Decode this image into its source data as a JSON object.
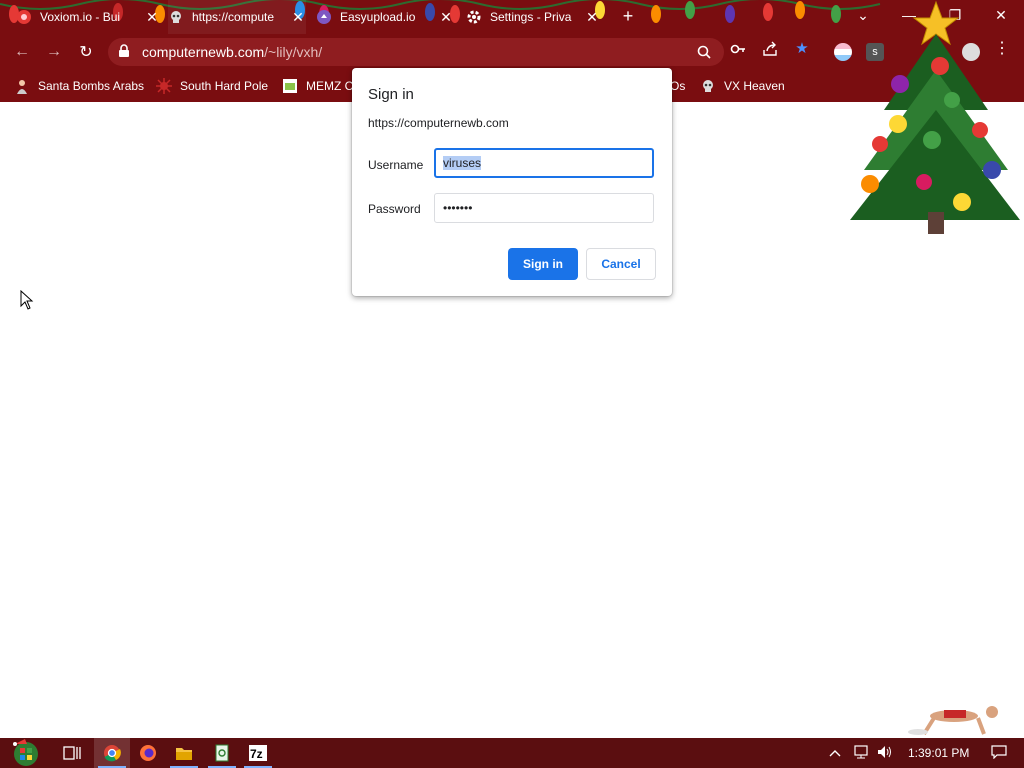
{
  "tabs": [
    {
      "title": "Voxiom.io - Bui",
      "favicon": "voxiom-icon",
      "active": false
    },
    {
      "title": "https://compute",
      "favicon": "pirate-icon",
      "active": true
    },
    {
      "title": "Easyupload.io",
      "favicon": "easyupload-icon",
      "active": false
    },
    {
      "title": "Settings - Priva",
      "favicon": "gear-icon",
      "active": false
    }
  ],
  "tab_close_glyph": "✕",
  "new_tab_glyph": "+",
  "window_controls": {
    "dropdown": "⌄",
    "minimize": "—",
    "restore": "❐",
    "close": "✕"
  },
  "toolbar": {
    "back": "←",
    "forward": "→",
    "reload": "↻",
    "url_host": "computernewb.com",
    "url_path": "/~lily/vxh/"
  },
  "bookmarks": [
    {
      "label": "Santa Bombs Arabs",
      "icon": "santa-icon"
    },
    {
      "label": "South Hard Pole",
      "icon": "virus-icon"
    },
    {
      "label": "MEMZ C",
      "icon": "memz-icon"
    },
    {
      "label": "Os",
      "icon": "folder-icon"
    },
    {
      "label": "VX Heaven",
      "icon": "pirate-icon"
    }
  ],
  "dialog": {
    "title": "Sign in",
    "origin": "https://computernewb.com",
    "username_label": "Username",
    "username_value": "viruses",
    "password_label": "Password",
    "password_value": "•••••••",
    "sign_in_label": "Sign in",
    "cancel_label": "Cancel"
  },
  "taskbar": {
    "items": [
      "task-view",
      "chrome",
      "firefox",
      "file-explorer",
      "notepad",
      "7zip"
    ],
    "clock": "1:39:01 PM"
  },
  "colors": {
    "theme": "#7a0d10",
    "taskbar": "#5b0e10",
    "accent": "#1a73e8",
    "selection": "#b4cdf5"
  }
}
